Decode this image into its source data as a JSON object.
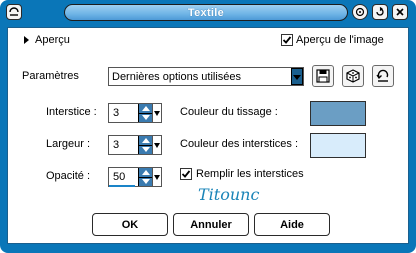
{
  "window": {
    "title": "Textile"
  },
  "titlebar": {
    "icons": [
      "system-menu-icon",
      "help-icon",
      "minimize-icon",
      "close-icon"
    ]
  },
  "preview": {
    "toggle_label": "Aperçu",
    "image_checkbox_label": "Aperçu de l'image",
    "image_checked": true
  },
  "params": {
    "label": "Paramètres",
    "preset_value": "Dernières options utilisées",
    "buttons": [
      "save-preset-icon",
      "random-icon",
      "reset-icon"
    ]
  },
  "fields": {
    "interstice_label": "Interstice :",
    "interstice_value": "3",
    "largeur_label": "Largeur :",
    "largeur_value": "3",
    "opacite_label": "Opacité :",
    "opacite_value": "50",
    "weave_color_label": "Couleur du tissage :",
    "gap_color_label": "Couleur des interstices :",
    "fill_label": "Remplir les interstices",
    "fill_checked": true
  },
  "colors": {
    "weave": "#6b9ec4",
    "gap": "#d8ecfb",
    "frame": "#0a76b8"
  },
  "signature": "Titounc",
  "buttons": {
    "ok": "OK",
    "cancel": "Annuler",
    "help": "Aide"
  }
}
